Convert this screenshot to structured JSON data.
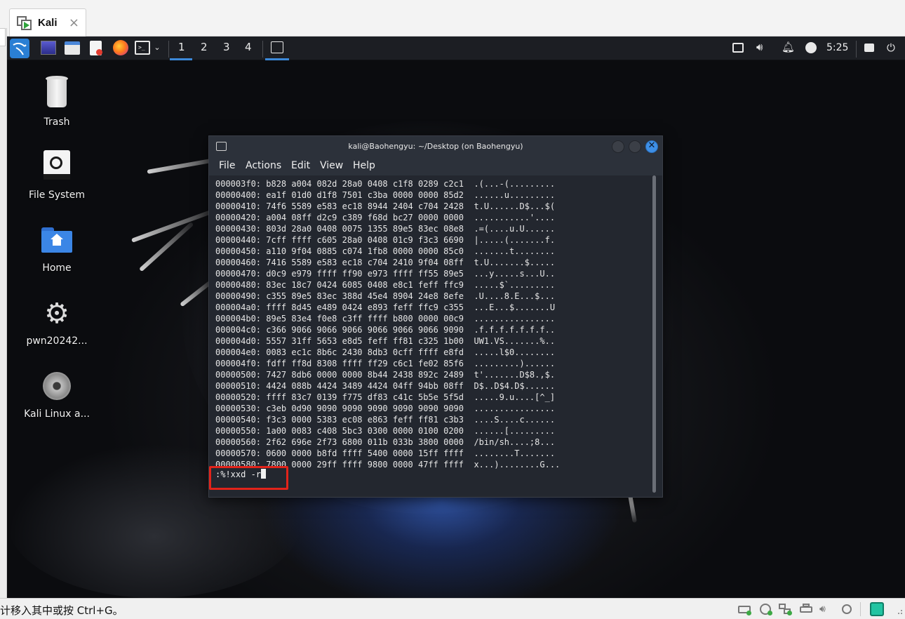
{
  "host": {
    "tab_label": "Kali",
    "tab_close": "×",
    "status_hint": "计移入其中或按 Ctrl+G。"
  },
  "panel": {
    "workspaces": [
      "1",
      "2",
      "3",
      "4"
    ],
    "clock": "5:25",
    "active_workspace": "1",
    "accent_color": "#3c88d8"
  },
  "desktop_icons": [
    {
      "label": "Trash",
      "icon": "trash-icon"
    },
    {
      "label": "File System",
      "icon": "drive-icon"
    },
    {
      "label": "Home",
      "icon": "home-folder-icon"
    },
    {
      "label": "pwn20242...",
      "icon": "gear-icon"
    },
    {
      "label": "Kali Linux a...",
      "icon": "disc-icon"
    }
  ],
  "terminal": {
    "title": "kali@Baohengyu: ~/Desktop (on Baohengyu)",
    "menu": [
      "File",
      "Actions",
      "Edit",
      "View",
      "Help"
    ],
    "hex_lines": [
      "000003f0: b828 a004 082d 28a0 0408 c1f8 0289 c2c1  .(...-(.........",
      "00000400: ea1f 01d0 d1f8 7501 c3ba 0000 0000 85d2  ......u.........",
      "00000410: 74f6 5589 e583 ec18 8944 2404 c704 2428  t.U......D$...$(",
      "00000420: a004 08ff d2c9 c389 f68d bc27 0000 0000  ...........'....",
      "00000430: 803d 28a0 0408 0075 1355 89e5 83ec 08e8  .=(....u.U......",
      "00000440: 7cff ffff c605 28a0 0408 01c9 f3c3 6690  |.....(.......f.",
      "00000450: a110 9f04 0885 c074 1fb8 0000 0000 85c0  .......t........",
      "00000460: 7416 5589 e583 ec18 c704 2410 9f04 08ff  t.U.......$.....",
      "00000470: d0c9 e979 ffff ff90 e973 ffff ff55 89e5  ...y.....s...U..",
      "00000480: 83ec 18c7 0424 6085 0408 e8c1 feff ffc9  .....$`.........",
      "00000490: c355 89e5 83ec 388d 45e4 8904 24e8 8efe  .U....8.E...$...",
      "000004a0: ffff 8d45 e489 0424 e893 feff ffc9 c355  ...E...$.......U",
      "000004b0: 89e5 83e4 f0e8 c3ff ffff b800 0000 00c9  ................",
      "000004c0: c366 9066 9066 9066 9066 9066 9066 9090  .f.f.f.f.f.f.f..",
      "000004d0: 5557 31ff 5653 e8d5 feff ff81 c325 1b00  UW1.VS.......%..",
      "000004e0: 0083 ec1c 8b6c 2430 8db3 0cff ffff e8fd  .....l$0........",
      "000004f0: fdff ff8d 8308 ffff ff29 c6c1 fe02 85f6  .........)......",
      "00000500: 7427 8db6 0000 0000 8b44 2438 892c 2489  t'.......D$8.,$.",
      "00000510: 4424 088b 4424 3489 4424 04ff 94bb 08ff  D$..D$4.D$......",
      "00000520: ffff 83c7 0139 f775 df83 c41c 5b5e 5f5d  .....9.u....[^_]",
      "00000530: c3eb 0d90 9090 9090 9090 9090 9090 9090  ................",
      "00000540: f3c3 0000 5383 ec08 e863 feff ff81 c3b3  ....S....c......",
      "00000550: 1a00 0083 c408 5bc3 0300 0000 0100 0200  ......[.........",
      "00000560: 2f62 696e 2f73 6800 011b 033b 3800 0000  /bin/sh....;8...",
      "00000570: 0600 0000 b8fd ffff 5400 0000 15ff ffff  ........T.......",
      "00000580: 7800 0000 29ff ffff 9800 0000 47ff ffff  x...)........G..."
    ],
    "command": ":%!xxd -r",
    "highlight_color": "#e2231a"
  }
}
